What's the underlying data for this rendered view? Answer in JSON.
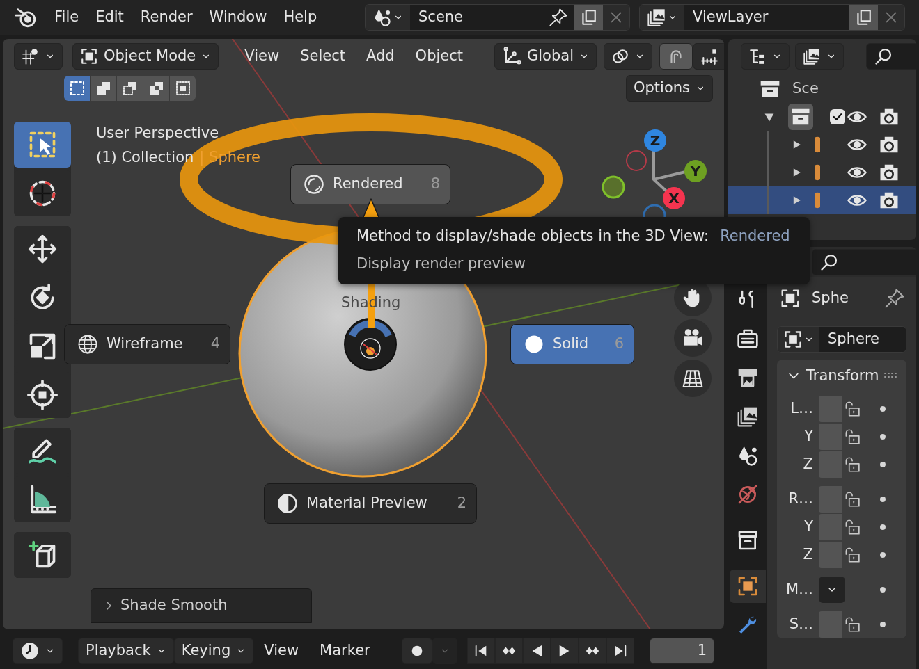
{
  "menu_bar": {
    "items": [
      "File",
      "Edit",
      "Render",
      "Window",
      "Help"
    ]
  },
  "scene": {
    "value": "Scene"
  },
  "view_layer": {
    "value": "ViewLayer"
  },
  "viewport_header": {
    "mode": "Object Mode",
    "menus": [
      "View",
      "Select",
      "Add",
      "Object"
    ],
    "orientation": "Global",
    "snap_enabled": true,
    "options": "Options"
  },
  "select_modes": [
    {
      "kind": "set",
      "selected": true
    },
    {
      "kind": "extend",
      "selected": false
    },
    {
      "kind": "subtract",
      "selected": false
    },
    {
      "kind": "invert",
      "selected": false
    },
    {
      "kind": "intersect",
      "selected": false
    }
  ],
  "toolbar": [
    {
      "kind": "select_box",
      "selected": true
    },
    {
      "kind": "cursor",
      "selected": false
    },
    {
      "kind": "move",
      "selected": false
    },
    {
      "kind": "rotate",
      "selected": false
    },
    {
      "kind": "scale",
      "selected": false
    },
    {
      "kind": "transform",
      "selected": false
    },
    {
      "kind": "annotate",
      "selected": false
    },
    {
      "kind": "measure",
      "selected": false
    },
    {
      "kind": "add_cube",
      "selected": false
    }
  ],
  "viewport_text": {
    "view": "User Perspective",
    "collection": "(1) Collection",
    "active": "| Sphere"
  },
  "gizmo": {
    "axes": [
      {
        "label": "Z",
        "color": "#2f86e0"
      },
      {
        "label": "Y",
        "color": "#6ea022"
      },
      {
        "label": "X",
        "color": "#f5344f"
      }
    ]
  },
  "pie_menu": {
    "title": "Shading",
    "items": [
      {
        "kind": "rendered",
        "label": "Rendered",
        "shortcut": "8",
        "selected": false,
        "highlighted": true
      },
      {
        "kind": "wireframe",
        "label": "Wireframe",
        "shortcut": "4",
        "selected": false,
        "highlighted": false
      },
      {
        "kind": "solid",
        "label": "Solid",
        "shortcut": "6",
        "selected": true,
        "highlighted": false
      },
      {
        "kind": "material",
        "label": "Material Preview",
        "shortcut": "2",
        "selected": false,
        "highlighted": false
      }
    ]
  },
  "tooltip": {
    "text": "Method to display/shade objects in the 3D View:",
    "value": "Rendered",
    "description": "Display render preview"
  },
  "last_operation": {
    "label": "Shade Smooth",
    "expanded": false
  },
  "outliner": {
    "scene": "Sce",
    "collections": [
      {
        "expanded": true,
        "checked": true,
        "children": [
          {
            "expanded": false,
            "selected": false
          },
          {
            "expanded": false,
            "selected": false
          },
          {
            "expanded": false,
            "selected": true
          }
        ]
      }
    ]
  },
  "properties": {
    "tabs": [
      {
        "kind": "tool",
        "selected": false
      },
      {
        "kind": "render",
        "selected": false
      },
      {
        "kind": "output",
        "selected": false
      },
      {
        "kind": "view_layer",
        "selected": false
      },
      {
        "kind": "scene",
        "selected": false
      },
      {
        "kind": "world",
        "selected": false
      },
      {
        "kind": "collection",
        "selected": false
      },
      {
        "kind": "object",
        "selected": true
      },
      {
        "kind": "modifier",
        "selected": false
      }
    ],
    "context": "Sphe",
    "object_name": "Sphere",
    "panel": {
      "title": "Transform",
      "expanded": true,
      "rows": [
        {
          "label": "L…",
          "kind": "field"
        },
        {
          "label": "Y",
          "kind": "field"
        },
        {
          "label": "Z",
          "kind": "field"
        },
        {
          "label": "R…",
          "kind": "field"
        },
        {
          "label": "Y",
          "kind": "field"
        },
        {
          "label": "Z",
          "kind": "field"
        },
        {
          "label": "M…",
          "kind": "dropdown"
        },
        {
          "label": "S…",
          "kind": "field"
        }
      ]
    }
  },
  "timeline": {
    "menus": [
      {
        "label": "Playback",
        "dropdown": true
      },
      {
        "label": "Keying",
        "dropdown": true
      },
      {
        "label": "View",
        "dropdown": false
      },
      {
        "label": "Marker",
        "dropdown": false
      }
    ],
    "transport": [
      {
        "kind": "jump_start"
      },
      {
        "kind": "key_prev"
      },
      {
        "kind": "play_reverse"
      },
      {
        "kind": "play"
      },
      {
        "kind": "key_next"
      },
      {
        "kind": "jump_end"
      }
    ],
    "frame": "1"
  }
}
